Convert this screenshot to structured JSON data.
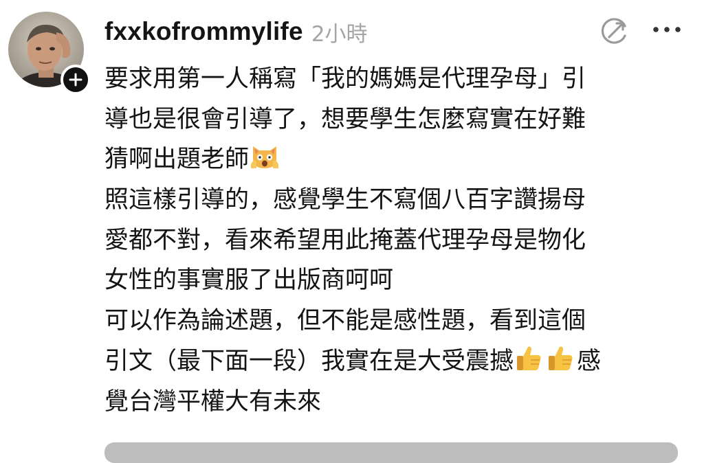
{
  "post": {
    "username": "fxxkofrommylife",
    "time_ago": "2小時",
    "lines": [
      "要求用第一人稱寫「我的媽媽是代理孕母」引",
      "導也是很會引導了，想要學生怎麼寫實在好難",
      "猜啊出題老師",
      "照這樣引導的，感覺學生不寫個八百字讚揚母",
      "愛都不對，看來希望用此掩蓋代理孕母是物化",
      "女性的事實服了出版商呵呵",
      "可以作為論述題，但不能是感性題，看到這個",
      "引文（最下面一段）我實在是大受震撼",
      "感",
      "覺台灣平權大有未來"
    ]
  },
  "icons": {
    "avatar": "user-photo",
    "follow": "plus-icon",
    "translate": "translate-icon",
    "more": "more-icon",
    "emoji_shocked": "scared-cat-emoji",
    "emoji_thumb": "thumbs-up-emoji"
  },
  "colors": {
    "text": "#141414",
    "meta": "#a5a5a5",
    "icon": "#9a9a9a"
  }
}
